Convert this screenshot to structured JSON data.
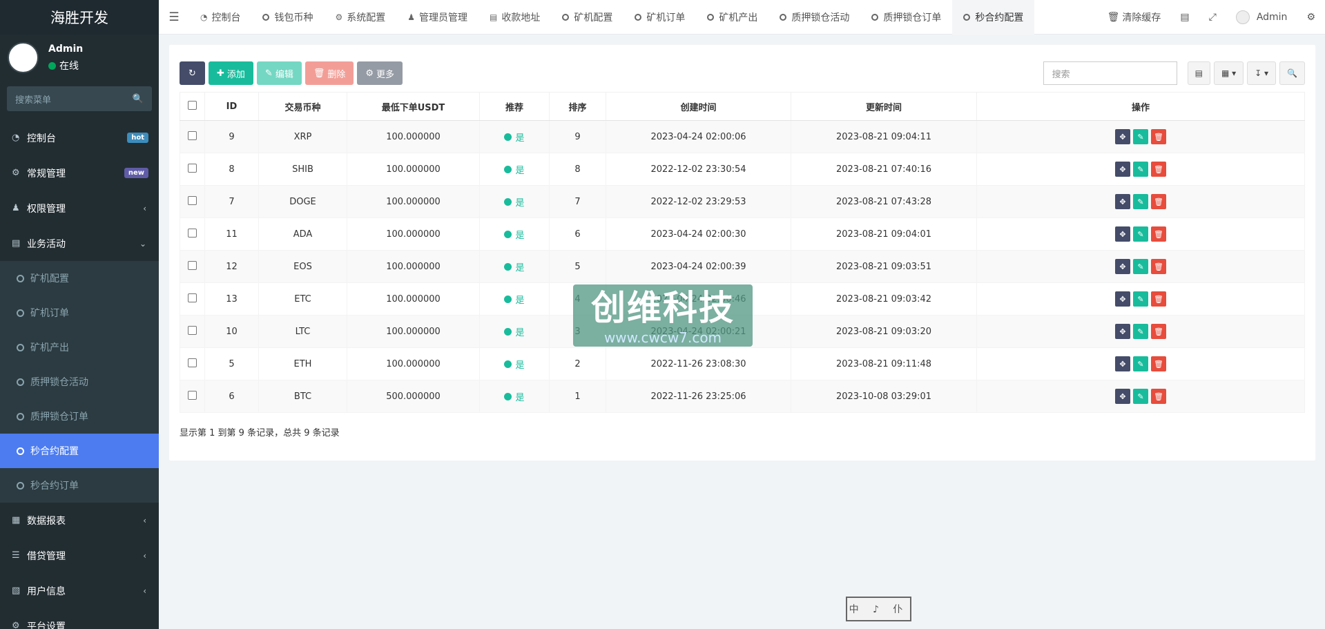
{
  "sidebar": {
    "logo": "海胜开发",
    "user": {
      "name": "Admin",
      "status": "在线"
    },
    "search_placeholder": "搜索菜单",
    "menu": [
      {
        "label": "控制台",
        "icon": "dashboard-icon",
        "badge": "hot",
        "badge_color": "#3c8dbc"
      },
      {
        "label": "常规管理",
        "icon": "cogs-icon",
        "badge": "new",
        "badge_color": "#605ca8"
      },
      {
        "label": "权限管理",
        "icon": "group-icon"
      },
      {
        "label": "业务活动",
        "icon": "id-card-icon"
      }
    ],
    "submenu": [
      "矿机配置",
      "矿机订单",
      "矿机产出",
      "质押锁仓活动",
      "质押锁仓订单",
      "秒合约配置",
      "秒合约订单"
    ],
    "menu_after": [
      {
        "label": "数据报表",
        "icon": "file-icon"
      },
      {
        "label": "借贷管理",
        "icon": "list-icon"
      },
      {
        "label": "用户信息",
        "icon": "address-book-icon"
      },
      {
        "label": "平台设置",
        "icon": "gear-icon"
      }
    ]
  },
  "topbar": {
    "tabs": [
      "控制台",
      "钱包币种",
      "系统配置",
      "管理员管理",
      "收款地址",
      "矿机配置",
      "矿机订单",
      "矿机产出",
      "质押锁仓活动",
      "质押锁仓订单",
      "秒合约配置"
    ],
    "clear_cache": "清除缓存",
    "user": "Admin"
  },
  "toolbar": {
    "add": "添加",
    "edit": "编辑",
    "delete": "删除",
    "more": "更多",
    "search_placeholder": "搜索"
  },
  "table": {
    "headers": [
      "ID",
      "交易币种",
      "最低下单USDT",
      "推荐",
      "排序",
      "创建时间",
      "更新时间",
      "操作"
    ],
    "rows": [
      [
        "9",
        "XRP",
        "100.000000",
        "是",
        "9",
        "2023-04-24 02:00:06",
        "2023-08-21 09:04:11"
      ],
      [
        "8",
        "SHIB",
        "100.000000",
        "是",
        "8",
        "2022-12-02 23:30:54",
        "2023-08-21 07:40:16"
      ],
      [
        "7",
        "DOGE",
        "100.000000",
        "是",
        "7",
        "2022-12-02 23:29:53",
        "2023-08-21 07:43:28"
      ],
      [
        "11",
        "ADA",
        "100.000000",
        "是",
        "6",
        "2023-04-24 02:00:30",
        "2023-08-21 09:04:01"
      ],
      [
        "12",
        "EOS",
        "100.000000",
        "是",
        "5",
        "2023-04-24 02:00:39",
        "2023-08-21 09:03:51"
      ],
      [
        "13",
        "ETC",
        "100.000000",
        "是",
        "4",
        "2023-04-24 02:00:46",
        "2023-08-21 09:03:42"
      ],
      [
        "10",
        "LTC",
        "100.000000",
        "是",
        "3",
        "2023-04-24 02:00:21",
        "2023-08-21 09:03:20"
      ],
      [
        "5",
        "ETH",
        "100.000000",
        "是",
        "2",
        "2022-11-26 23:08:30",
        "2023-08-21 09:11:48"
      ],
      [
        "6",
        "BTC",
        "500.000000",
        "是",
        "1",
        "2022-11-26 23:25:06",
        "2023-10-08 03:29:01"
      ]
    ]
  },
  "footer_info": "显示第 1 到第 9 条记录，总共 9 条记录",
  "watermark": {
    "title": "创维科技",
    "url": "www.cwcw7.com"
  },
  "seal_text": "中 ♪ 仆"
}
